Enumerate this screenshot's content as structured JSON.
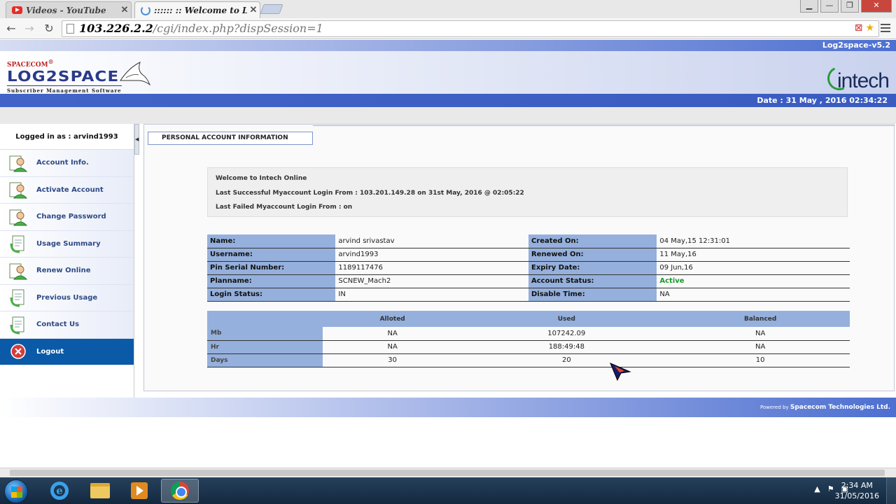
{
  "browser": {
    "tabs": [
      {
        "title": "Videos - YouTube",
        "active": false
      },
      {
        "title": ":::::: :: Welcome to LoC",
        "active": true
      }
    ],
    "url_host": "103.226.2.2",
    "url_path": "/cgi/index.php?dispSession=1"
  },
  "header": {
    "logo_company": "SPACECOM",
    "logo_product": "LOG2SPACE",
    "logo_tagline": "Subscriber Management Software",
    "version": "Log2space-v5.2",
    "brand_right": "intech",
    "date": "Date : 31 May , 2016 02:34:22"
  },
  "sidebar": {
    "logged_in": "Logged in as : arvind1993",
    "items": [
      {
        "label": "Account Info.",
        "icon": "user-icon"
      },
      {
        "label": "Activate Account",
        "icon": "user-icon"
      },
      {
        "label": "Change Password",
        "icon": "user-icon"
      },
      {
        "label": "Usage Summary",
        "icon": "document-icon"
      },
      {
        "label": "Renew Online",
        "icon": "user-icon"
      },
      {
        "label": "Previous Usage",
        "icon": "document-icon"
      },
      {
        "label": "Contact Us",
        "icon": "document-icon"
      },
      {
        "label": "Logout",
        "icon": "logout-icon"
      }
    ]
  },
  "main": {
    "tab_title": "PERSONAL ACCOUNT INFORMATION",
    "welcome": {
      "line1": "Welcome to Intech Online",
      "line2": "Last Successful Myaccount Login From : 103.201.149.28 on 31st May, 2016 @ 02:05:22",
      "line3": "Last Failed Myaccount Login From : on"
    },
    "account": {
      "rows": [
        {
          "label1": "Name:",
          "value1": "arvind srivastav",
          "label2": "Created On:",
          "value2": "04 May,15 12:31:01"
        },
        {
          "label1": "Username:",
          "value1": "arvind1993",
          "label2": "Renewed On:",
          "value2": "11 May,16"
        },
        {
          "label1": "Pin Serial Number:",
          "value1": "1189117476",
          "label2": "Expiry Date:",
          "value2": "09 Jun,16"
        },
        {
          "label1": "Planname:",
          "value1": "SCNEW_Mach2",
          "label2": "Account Status:",
          "value2": "Active"
        },
        {
          "label1": "Login Status:",
          "value1": "IN",
          "label2": "Disable Time:",
          "value2": "NA"
        }
      ],
      "status_color": "#1a9a2a"
    },
    "usage": {
      "headers": [
        "",
        "Alloted",
        "Used",
        "Balanced"
      ],
      "rows": [
        {
          "label": "Mb",
          "alloted": "NA",
          "used": "107242.09",
          "balanced": "NA"
        },
        {
          "label": "Hr",
          "alloted": "NA",
          "used": "188:49:48",
          "balanced": "NA"
        },
        {
          "label": "Days",
          "alloted": "30",
          "used": "20",
          "balanced": "10"
        }
      ]
    }
  },
  "footer": {
    "powered_by": "Powered by",
    "company": "Spacecom Technologies Ltd."
  },
  "taskbar": {
    "time": "2:34 AM",
    "date": "31/05/2016"
  },
  "colors": {
    "accent_blue": "#4264c8",
    "label_blue": "#95b0dc",
    "nav_text": "#2e4a86",
    "logout_bg": "#0a5aa8"
  }
}
